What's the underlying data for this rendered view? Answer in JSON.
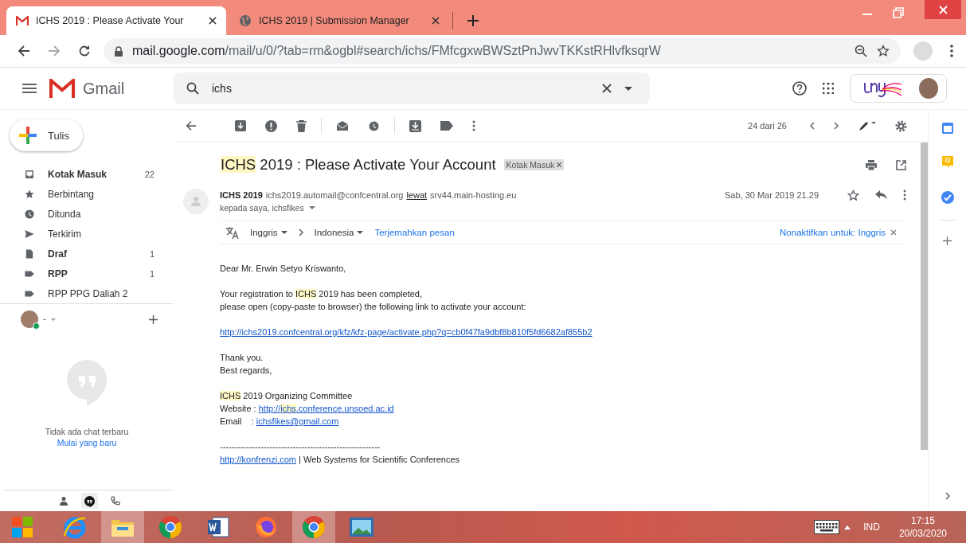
{
  "browser": {
    "tabs": [
      {
        "title": "ICHS 2019 : Please Activate Your",
        "kind": "gmail",
        "selected": true
      },
      {
        "title": "ICHS 2019 | Submission Manager",
        "kind": "globe",
        "selected": false
      }
    ],
    "url": {
      "host": "mail.google.com",
      "path": "/mail/u/0/?tab=rm&ogbl#search/ichs/FMfcgxwBWSztPnJwvTKKstRHlvfksqrW"
    }
  },
  "gmail": {
    "brand": "Gmail",
    "search": {
      "value": "ichs"
    },
    "compose": "Tulis",
    "folders": [
      {
        "kind": "inbox",
        "label": "Kotak Masuk",
        "count": "22",
        "unread": true
      },
      {
        "kind": "starred",
        "label": "Berbintang",
        "unread": false
      },
      {
        "kind": "snoozed",
        "label": "Ditunda",
        "unread": false
      },
      {
        "kind": "sent",
        "label": "Terkirim",
        "unread": false
      },
      {
        "kind": "drafts",
        "label": "Draf",
        "count": "1",
        "unread": true
      },
      {
        "kind": "label",
        "label": "RPP",
        "count": "1",
        "unread": true
      },
      {
        "kind": "label",
        "label": "RPP PPG Daliah 2",
        "unread": false
      }
    ],
    "hangouts": {
      "user": "-",
      "empty": "Tidak ada chat terbaru",
      "start": "Mulai yang baru"
    },
    "counter": "24 dari 26",
    "message": {
      "subject": [
        {
          "text": "ICHS",
          "highlighted": true
        },
        {
          "text": " 2019 : Please Activate Your Account",
          "highlighted": false
        }
      ],
      "label": "Kotak Masuk",
      "sender": {
        "name": "ICHS 2019",
        "email": "ichs2019.automail@confcentral.org",
        "via": "lewat",
        "server": "srv44.main-hosting.eu"
      },
      "recipients": "kepada saya, ichsfikes",
      "date": "Sab, 30 Mar 2019 21.29",
      "translate": {
        "from": "Inggris",
        "to": "Indonesia",
        "action": "Terjemahkan pesan",
        "disable": "Nonaktifkan untuk: Inggris"
      },
      "body": [
        [
          [
            {
              "kind": "text",
              "text": "Dear Mr. Erwin Setyo Kriswanto,",
              "highlighted": false
            }
          ]
        ],
        [
          [
            {
              "kind": "text",
              "text": "Your registration to ",
              "highlighted": false
            },
            {
              "kind": "text",
              "text": "ICHS",
              "highlighted": true
            },
            {
              "kind": "text",
              "text": " 2019 has been completed,",
              "highlighted": false
            }
          ],
          [
            {
              "kind": "text",
              "text": "please open (copy-paste to browser) the following link to activate your account:",
              "highlighted": false
            }
          ]
        ],
        [
          [
            {
              "kind": "link",
              "segments": [
                {
                  "text": "http://ichs2019.confcentral.org/kfz/kfz-page/activate.php?q=cb0f47fa9dbf8b810f5fd6682af855b2",
                  "highlighted": false
                }
              ]
            }
          ]
        ],
        [
          [
            {
              "kind": "text",
              "text": "Thank you.",
              "highlighted": false
            }
          ],
          [
            {
              "kind": "text",
              "text": "Best regards,",
              "highlighted": false
            }
          ]
        ],
        [
          [
            {
              "kind": "text",
              "text": "ICHS",
              "highlighted": true
            },
            {
              "kind": "text",
              "text": " 2019 Organizing Committee",
              "highlighted": false
            }
          ],
          [
            {
              "kind": "text",
              "text": "Website : ",
              "highlighted": false
            },
            {
              "kind": "link",
              "segments": [
                {
                  "text": "http://",
                  "highlighted": false
                },
                {
                  "text": "ichs",
                  "highlighted": true
                },
                {
                  "text": ".conference.unsoed.ac.id",
                  "highlighted": false
                }
              ]
            }
          ],
          [
            {
              "kind": "text",
              "text": "Email    : ",
              "highlighted": false
            },
            {
              "kind": "link",
              "segments": [
                {
                  "text": "ichsfikes@gmail.com",
                  "highlighted": false
                }
              ]
            }
          ]
        ],
        [
          [
            {
              "kind": "text",
              "text": "-------------------------------------------------------",
              "highlighted": false
            }
          ],
          [
            {
              "kind": "link",
              "segments": [
                {
                  "text": "http://konfrenzi.com",
                  "highlighted": false
                }
              ]
            },
            {
              "kind": "text",
              "text": " | Web Systems for Scientific Conferences",
              "highlighted": false
            }
          ]
        ]
      ]
    }
  },
  "taskbar": {
    "apps": [
      {
        "kind": "ie",
        "active": false
      },
      {
        "kind": "explorer",
        "active": true
      },
      {
        "kind": "chrome",
        "active": false
      },
      {
        "kind": "word",
        "active": false
      },
      {
        "kind": "firefox",
        "active": false
      },
      {
        "kind": "chrome",
        "active": true
      },
      {
        "kind": "photos",
        "active": false
      }
    ],
    "language": "IND",
    "time": "17:15",
    "date": "20/03/2020"
  }
}
